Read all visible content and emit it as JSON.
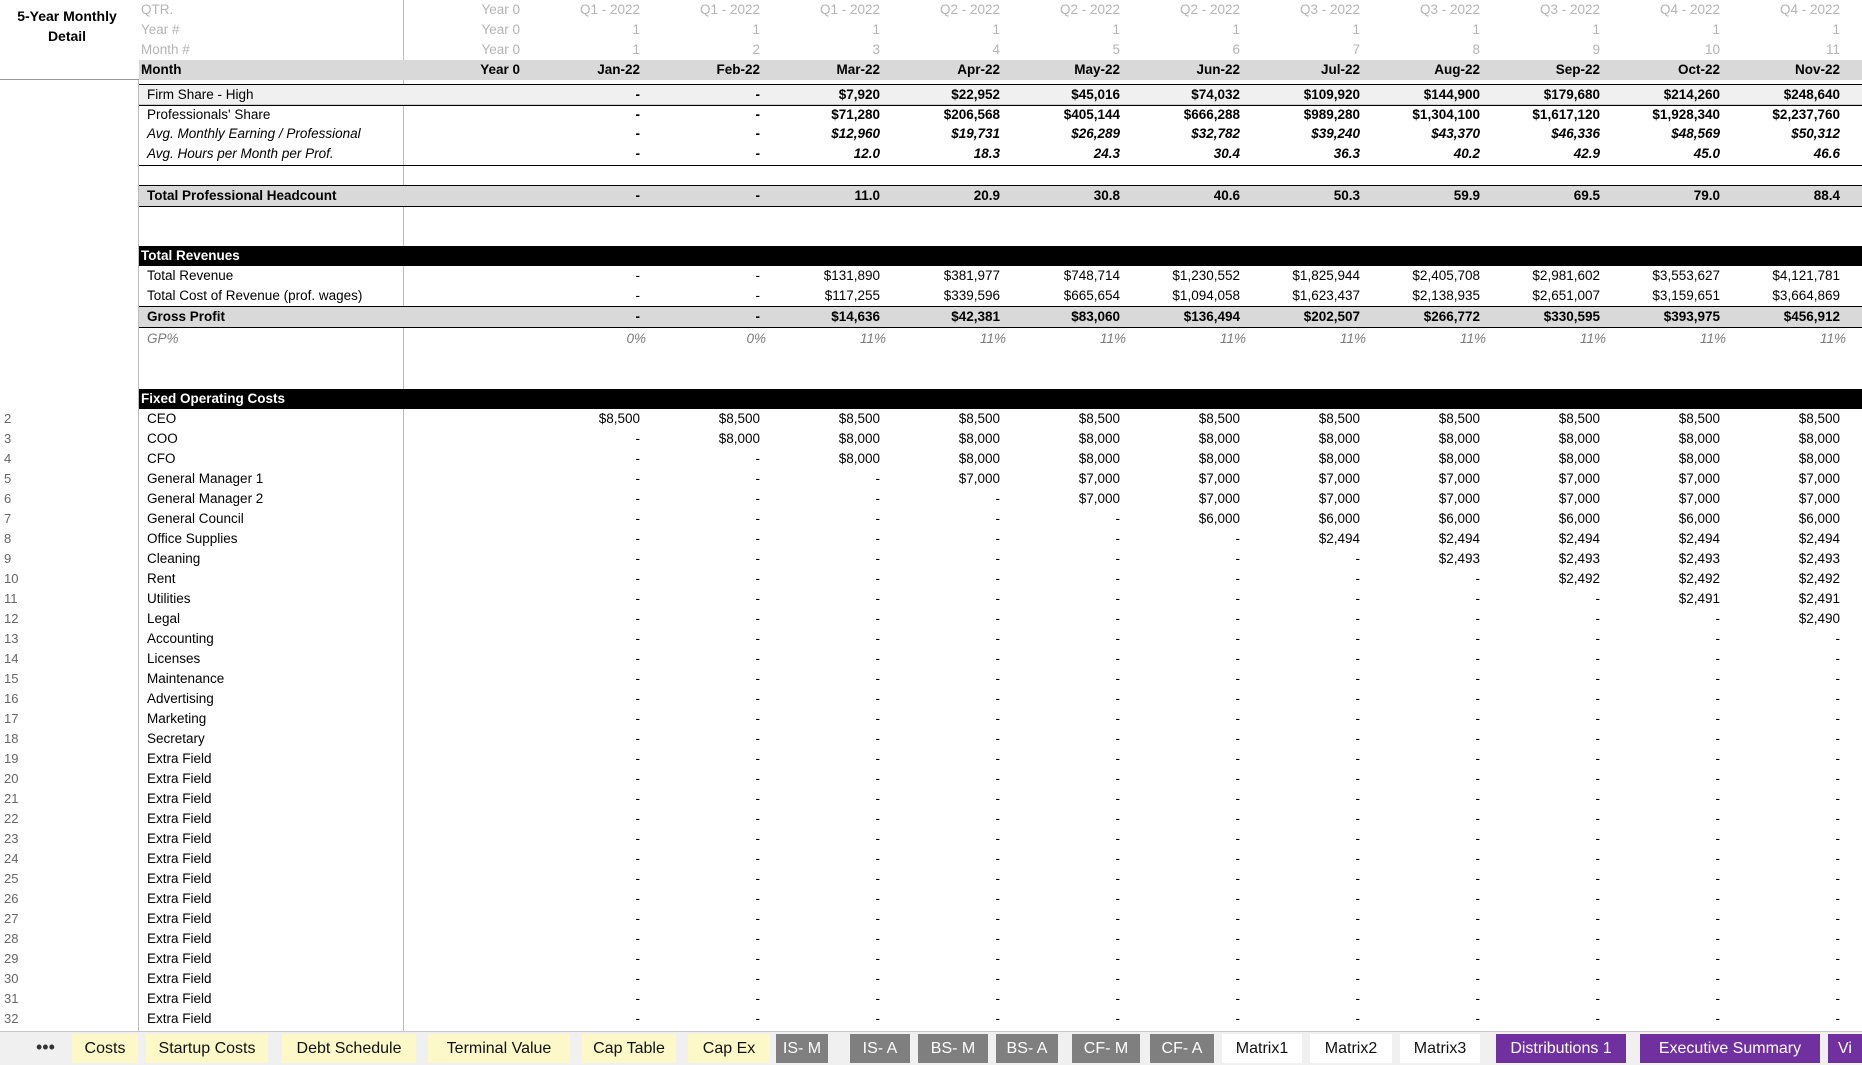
{
  "sheet_title": "5-Year Monthly Detail",
  "columns": [
    {
      "qtr": "Year 0",
      "year": "Year 0",
      "month_num": "Year 0",
      "month": "Year 0"
    },
    {
      "qtr": "Q1 - 2022",
      "year": "1",
      "month_num": "1",
      "month": "Jan-22"
    },
    {
      "qtr": "Q1 - 2022",
      "year": "1",
      "month_num": "2",
      "month": "Feb-22"
    },
    {
      "qtr": "Q1 - 2022",
      "year": "1",
      "month_num": "3",
      "month": "Mar-22"
    },
    {
      "qtr": "Q2 - 2022",
      "year": "1",
      "month_num": "4",
      "month": "Apr-22"
    },
    {
      "qtr": "Q2 - 2022",
      "year": "1",
      "month_num": "5",
      "month": "May-22"
    },
    {
      "qtr": "Q2 - 2022",
      "year": "1",
      "month_num": "6",
      "month": "Jun-22"
    },
    {
      "qtr": "Q3 - 2022",
      "year": "1",
      "month_num": "7",
      "month": "Jul-22"
    },
    {
      "qtr": "Q3 - 2022",
      "year": "1",
      "month_num": "8",
      "month": "Aug-22"
    },
    {
      "qtr": "Q3 - 2022",
      "year": "1",
      "month_num": "9",
      "month": "Sep-22"
    },
    {
      "qtr": "Q4 - 2022",
      "year": "1",
      "month_num": "10",
      "month": "Oct-22"
    },
    {
      "qtr": "Q4 - 2022",
      "year": "1",
      "month_num": "11",
      "month": "Nov-22"
    }
  ],
  "header_labels": {
    "qtr": "QTR.",
    "year": "Year #",
    "month_num": "Month #",
    "month": "Month"
  },
  "rows": [
    {
      "label": "Firm Share - High",
      "style": "light",
      "values": [
        "-",
        "-",
        "$7,920",
        "$22,952",
        "$45,016",
        "$74,032",
        "$109,920",
        "$144,900",
        "$179,680",
        "$214,260",
        "$248,640"
      ]
    },
    {
      "label": "Professionals' Share",
      "style": "plain-bold",
      "values": [
        "-",
        "-",
        "$71,280",
        "$206,568",
        "$405,144",
        "$666,288",
        "$989,280",
        "$1,304,100",
        "$1,617,120",
        "$1,928,340",
        "$2,237,760"
      ]
    },
    {
      "label": "Avg. Monthly Earning / Professional",
      "style": "italic-bold",
      "values": [
        "-",
        "-",
        "$12,960",
        "$19,731",
        "$26,289",
        "$32,782",
        "$39,240",
        "$43,370",
        "$46,336",
        "$48,569",
        "$50,312"
      ]
    },
    {
      "label": "Avg. Hours per Month per Prof.",
      "style": "italic-bold",
      "values": [
        "-",
        "-",
        "12.0",
        "18.3",
        "24.3",
        "30.4",
        "36.3",
        "40.2",
        "42.9",
        "45.0",
        "46.6"
      ]
    }
  ],
  "headcount": {
    "label": "Total Professional Headcount",
    "values": [
      "-",
      "-",
      "11.0",
      "20.9",
      "30.8",
      "40.6",
      "50.3",
      "59.9",
      "69.5",
      "79.0",
      "88.4"
    ]
  },
  "revenues": {
    "section_title": "Total Revenues",
    "total_revenue": {
      "label": "Total Revenue",
      "values": [
        "-",
        "-",
        "$131,890",
        "$381,977",
        "$748,714",
        "$1,230,552",
        "$1,825,944",
        "$2,405,708",
        "$2,981,602",
        "$3,553,627",
        "$4,121,781"
      ]
    },
    "cost_of_revenue": {
      "label": "Total Cost of Revenue (prof. wages)",
      "values": [
        "-",
        "-",
        "$117,255",
        "$339,596",
        "$665,654",
        "$1,094,058",
        "$1,623,437",
        "$2,138,935",
        "$2,651,007",
        "$3,159,651",
        "$3,664,869"
      ]
    },
    "gross_profit": {
      "label": "Gross Profit",
      "values": [
        "-",
        "-",
        "$14,636",
        "$42,381",
        "$83,060",
        "$136,494",
        "$202,507",
        "$266,772",
        "$330,595",
        "$393,975",
        "$456,912"
      ]
    },
    "gp_pct": {
      "label": "GP%",
      "values": [
        "0%",
        "0%",
        "11%",
        "11%",
        "11%",
        "11%",
        "11%",
        "11%",
        "11%",
        "11%",
        "11%"
      ]
    }
  },
  "fixed_costs": {
    "section_title": "Fixed Operating Costs",
    "items": [
      {
        "n": "2",
        "label": "CEO",
        "values": [
          "$8,500",
          "$8,500",
          "$8,500",
          "$8,500",
          "$8,500",
          "$8,500",
          "$8,500",
          "$8,500",
          "$8,500",
          "$8,500",
          "$8,500"
        ]
      },
      {
        "n": "3",
        "label": "COO",
        "values": [
          "-",
          "$8,000",
          "$8,000",
          "$8,000",
          "$8,000",
          "$8,000",
          "$8,000",
          "$8,000",
          "$8,000",
          "$8,000",
          "$8,000"
        ]
      },
      {
        "n": "4",
        "label": "CFO",
        "values": [
          "-",
          "-",
          "$8,000",
          "$8,000",
          "$8,000",
          "$8,000",
          "$8,000",
          "$8,000",
          "$8,000",
          "$8,000",
          "$8,000"
        ]
      },
      {
        "n": "5",
        "label": "General Manager 1",
        "values": [
          "-",
          "-",
          "-",
          "$7,000",
          "$7,000",
          "$7,000",
          "$7,000",
          "$7,000",
          "$7,000",
          "$7,000",
          "$7,000"
        ]
      },
      {
        "n": "6",
        "label": "General Manager 2",
        "values": [
          "-",
          "-",
          "-",
          "-",
          "$7,000",
          "$7,000",
          "$7,000",
          "$7,000",
          "$7,000",
          "$7,000",
          "$7,000"
        ]
      },
      {
        "n": "7",
        "label": "General Council",
        "values": [
          "-",
          "-",
          "-",
          "-",
          "-",
          "$6,000",
          "$6,000",
          "$6,000",
          "$6,000",
          "$6,000",
          "$6,000"
        ]
      },
      {
        "n": "8",
        "label": "Office Supplies",
        "values": [
          "-",
          "-",
          "-",
          "-",
          "-",
          "-",
          "$2,494",
          "$2,494",
          "$2,494",
          "$2,494",
          "$2,494"
        ]
      },
      {
        "n": "9",
        "label": "Cleaning",
        "values": [
          "-",
          "-",
          "-",
          "-",
          "-",
          "-",
          "-",
          "$2,493",
          "$2,493",
          "$2,493",
          "$2,493"
        ]
      },
      {
        "n": "10",
        "label": "Rent",
        "values": [
          "-",
          "-",
          "-",
          "-",
          "-",
          "-",
          "-",
          "-",
          "$2,492",
          "$2,492",
          "$2,492"
        ]
      },
      {
        "n": "11",
        "label": "Utilities",
        "values": [
          "-",
          "-",
          "-",
          "-",
          "-",
          "-",
          "-",
          "-",
          "-",
          "$2,491",
          "$2,491"
        ]
      },
      {
        "n": "12",
        "label": "Legal",
        "values": [
          "-",
          "-",
          "-",
          "-",
          "-",
          "-",
          "-",
          "-",
          "-",
          "-",
          "$2,490"
        ]
      },
      {
        "n": "13",
        "label": "Accounting",
        "values": [
          "-",
          "-",
          "-",
          "-",
          "-",
          "-",
          "-",
          "-",
          "-",
          "-",
          "-"
        ]
      },
      {
        "n": "14",
        "label": "Licenses",
        "values": [
          "-",
          "-",
          "-",
          "-",
          "-",
          "-",
          "-",
          "-",
          "-",
          "-",
          "-"
        ]
      },
      {
        "n": "15",
        "label": "Maintenance",
        "values": [
          "-",
          "-",
          "-",
          "-",
          "-",
          "-",
          "-",
          "-",
          "-",
          "-",
          "-"
        ]
      },
      {
        "n": "16",
        "label": "Advertising",
        "values": [
          "-",
          "-",
          "-",
          "-",
          "-",
          "-",
          "-",
          "-",
          "-",
          "-",
          "-"
        ]
      },
      {
        "n": "17",
        "label": "Marketing",
        "values": [
          "-",
          "-",
          "-",
          "-",
          "-",
          "-",
          "-",
          "-",
          "-",
          "-",
          "-"
        ]
      },
      {
        "n": "18",
        "label": "Secretary",
        "values": [
          "-",
          "-",
          "-",
          "-",
          "-",
          "-",
          "-",
          "-",
          "-",
          "-",
          "-"
        ]
      },
      {
        "n": "19",
        "label": "Extra Field",
        "values": [
          "-",
          "-",
          "-",
          "-",
          "-",
          "-",
          "-",
          "-",
          "-",
          "-",
          "-"
        ]
      },
      {
        "n": "20",
        "label": "Extra Field",
        "values": [
          "-",
          "-",
          "-",
          "-",
          "-",
          "-",
          "-",
          "-",
          "-",
          "-",
          "-"
        ]
      },
      {
        "n": "21",
        "label": "Extra Field",
        "values": [
          "-",
          "-",
          "-",
          "-",
          "-",
          "-",
          "-",
          "-",
          "-",
          "-",
          "-"
        ]
      },
      {
        "n": "22",
        "label": "Extra Field",
        "values": [
          "-",
          "-",
          "-",
          "-",
          "-",
          "-",
          "-",
          "-",
          "-",
          "-",
          "-"
        ]
      },
      {
        "n": "23",
        "label": "Extra Field",
        "values": [
          "-",
          "-",
          "-",
          "-",
          "-",
          "-",
          "-",
          "-",
          "-",
          "-",
          "-"
        ]
      },
      {
        "n": "24",
        "label": "Extra Field",
        "values": [
          "-",
          "-",
          "-",
          "-",
          "-",
          "-",
          "-",
          "-",
          "-",
          "-",
          "-"
        ]
      },
      {
        "n": "25",
        "label": "Extra Field",
        "values": [
          "-",
          "-",
          "-",
          "-",
          "-",
          "-",
          "-",
          "-",
          "-",
          "-",
          "-"
        ]
      },
      {
        "n": "26",
        "label": "Extra Field",
        "values": [
          "-",
          "-",
          "-",
          "-",
          "-",
          "-",
          "-",
          "-",
          "-",
          "-",
          "-"
        ]
      },
      {
        "n": "27",
        "label": "Extra Field",
        "values": [
          "-",
          "-",
          "-",
          "-",
          "-",
          "-",
          "-",
          "-",
          "-",
          "-",
          "-"
        ]
      },
      {
        "n": "28",
        "label": "Extra Field",
        "values": [
          "-",
          "-",
          "-",
          "-",
          "-",
          "-",
          "-",
          "-",
          "-",
          "-",
          "-"
        ]
      },
      {
        "n": "29",
        "label": "Extra Field",
        "values": [
          "-",
          "-",
          "-",
          "-",
          "-",
          "-",
          "-",
          "-",
          "-",
          "-",
          "-"
        ]
      },
      {
        "n": "30",
        "label": "Extra Field",
        "values": [
          "-",
          "-",
          "-",
          "-",
          "-",
          "-",
          "-",
          "-",
          "-",
          "-",
          "-"
        ]
      },
      {
        "n": "31",
        "label": "Extra Field",
        "values": [
          "-",
          "-",
          "-",
          "-",
          "-",
          "-",
          "-",
          "-",
          "-",
          "-",
          "-"
        ]
      },
      {
        "n": "32",
        "label": "Extra Field",
        "values": [
          "-",
          "-",
          "-",
          "-",
          "-",
          "-",
          "-",
          "-",
          "-",
          "-",
          "-"
        ]
      }
    ]
  },
  "sheet_tabs": [
    {
      "label": "Costs",
      "color": "yellow"
    },
    {
      "label": "Startup Costs",
      "color": "yellow"
    },
    {
      "label": "Debt Schedule",
      "color": "yellow"
    },
    {
      "label": "Terminal Value",
      "color": "yellow"
    },
    {
      "label": "Cap Table",
      "color": "yellow"
    },
    {
      "label": "Cap Ex",
      "color": "yellow"
    },
    {
      "label": "IS- M",
      "color": "gray"
    },
    {
      "label": "IS- A",
      "color": "gray"
    },
    {
      "label": "BS- M",
      "color": "gray"
    },
    {
      "label": "BS- A",
      "color": "gray"
    },
    {
      "label": "CF- M",
      "color": "gray"
    },
    {
      "label": "CF- A",
      "color": "gray"
    },
    {
      "label": "Matrix1",
      "color": "white"
    },
    {
      "label": "Matrix2",
      "color": "white"
    },
    {
      "label": "Matrix3",
      "color": "white"
    },
    {
      "label": "Distributions 1",
      "color": "purple"
    },
    {
      "label": "Executive Summary",
      "color": "purple"
    },
    {
      "label": "Vi",
      "color": "purple"
    }
  ],
  "more_tabs_glyph": "•••"
}
